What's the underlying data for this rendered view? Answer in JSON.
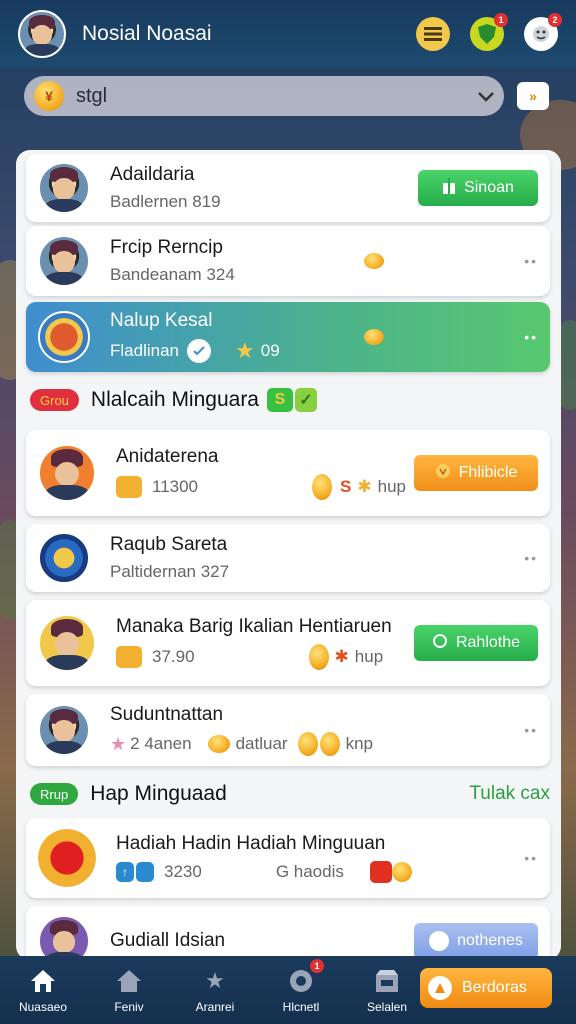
{
  "header": {
    "title": "Nosial Noasai",
    "icons": [
      "menu-icon",
      "shield-icon",
      "badge-icon"
    ],
    "notification_badge": "1",
    "profile_badge": "2"
  },
  "searchbar": {
    "label": "stgl",
    "coin_glyph": "¥",
    "side_glyph": "»"
  },
  "rows": [
    {
      "name": "Adaildaria",
      "sub": "Badlernen 819",
      "button": "Sinoan"
    },
    {
      "name": "Frcip Rerncip",
      "sub": "Bandeanam 324"
    },
    {
      "name": "Nalup Kesal",
      "sub": "Fladlinan",
      "value": "09"
    },
    {
      "name": "Anidaterena",
      "value": "11300",
      "coin": "S",
      "unit": "hup",
      "button": "Fhlibicle"
    },
    {
      "name": "Raqub Sareta",
      "sub": "Paltidernan 327"
    },
    {
      "name": "Manaka Barig Ikalian Hentiaruen",
      "value": "37.90",
      "unit": "hup",
      "button": "Rahlothe"
    },
    {
      "name": "Suduntnattan",
      "badge": "2 4anen",
      "label": "datluar",
      "unit": "knp"
    },
    {
      "name": "Hadiah Hadin Hadiah Minguuan",
      "value": "3230",
      "extra": "G haodis"
    },
    {
      "name": "Gudiall Idsian",
      "button": "nothenes"
    }
  ],
  "sections": [
    {
      "tag": "Grou",
      "title": "Nlalcaih Minguara"
    },
    {
      "tag": "Rrup",
      "title": "Hap Minguaad",
      "link": "Tulak cax"
    }
  ],
  "bottom_nav": {
    "items": [
      {
        "label": "Nuasaeo",
        "icon": "home-icon"
      },
      {
        "label": "Feniv",
        "icon": "house-icon"
      },
      {
        "label": "Aranrei",
        "icon": "star-icon"
      },
      {
        "label": "Hlcnetl",
        "icon": "trophy-icon",
        "badge": "1"
      },
      {
        "label": "Selalen",
        "icon": "shop-icon"
      }
    ],
    "cta": "Berdoras"
  },
  "colors": {
    "accent_green": "#27ad4a",
    "accent_orange": "#f0901a",
    "highlight_row": "#3fa8a0",
    "header_bg": "#173a5e"
  }
}
